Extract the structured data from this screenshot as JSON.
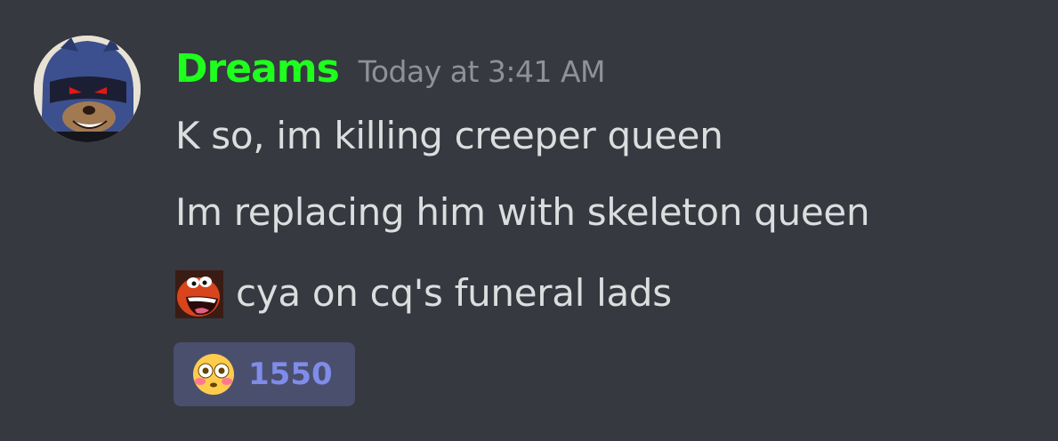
{
  "message": {
    "author": {
      "name": "Dreams",
      "name_color": "#1eff1e",
      "avatar": "sonic-exe-avatar"
    },
    "timestamp": "Today at 3:41 AM",
    "lines": [
      "K so, im killing creeper queen",
      "Im replacing him with skeleton queen",
      "cya on cq's funeral lads"
    ],
    "inline_emoji": "crash-laughing-emoji",
    "reaction": {
      "emoji": "flushed-face-emoji",
      "count": "1550"
    }
  },
  "colors": {
    "background": "#36393f",
    "text": "#dcddde",
    "timestamp": "#8e9297",
    "reaction_bg": "#4a4f6e",
    "reaction_text": "#7f8ce8"
  }
}
